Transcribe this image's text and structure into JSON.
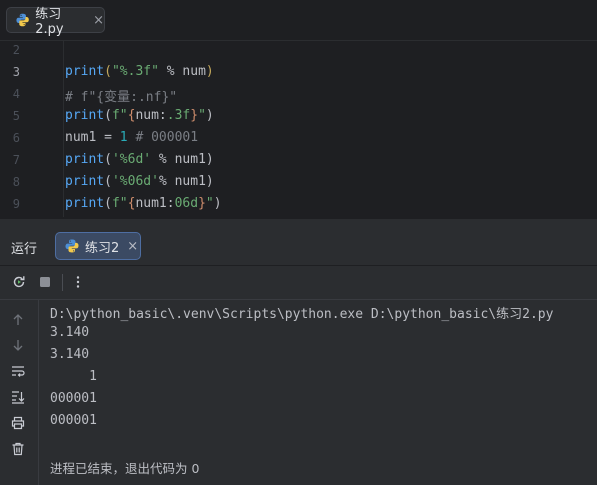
{
  "editor_tab": {
    "label": "练习2.py",
    "close": "×"
  },
  "editor": {
    "line_numbers": [
      "2",
      "3",
      "4",
      "5",
      "6",
      "7",
      "8",
      "9"
    ],
    "lines": [
      {
        "parts": []
      },
      {
        "parts": [
          {
            "t": "print",
            "c": "fn"
          },
          {
            "t": "(",
            "c": "bp"
          },
          {
            "t": "\"%.3f\"",
            "c": "str"
          },
          {
            "t": " % num",
            "c": "id"
          },
          {
            "t": ")",
            "c": "bp"
          }
        ]
      },
      {
        "parts": [
          {
            "t": "# f\"{变量:.nf}\"",
            "c": "cmt"
          }
        ]
      },
      {
        "parts": [
          {
            "t": "print",
            "c": "fn"
          },
          {
            "t": "(",
            "c": "id"
          },
          {
            "t": "f\"",
            "c": "str"
          },
          {
            "t": "{",
            "c": "fb"
          },
          {
            "t": "num:",
            "c": "id"
          },
          {
            "t": ".3f",
            "c": "str"
          },
          {
            "t": "}",
            "c": "fb"
          },
          {
            "t": "\"",
            "c": "str"
          },
          {
            "t": ")",
            "c": "id"
          }
        ]
      },
      {
        "parts": [
          {
            "t": "num1 = ",
            "c": "id"
          },
          {
            "t": "1",
            "c": "num"
          },
          {
            "t": " # 000001",
            "c": "cmt"
          }
        ]
      },
      {
        "parts": [
          {
            "t": "print",
            "c": "fn"
          },
          {
            "t": "(",
            "c": "id"
          },
          {
            "t": "'%6d'",
            "c": "str"
          },
          {
            "t": " % num1)",
            "c": "id"
          }
        ]
      },
      {
        "parts": [
          {
            "t": "print",
            "c": "fn"
          },
          {
            "t": "(",
            "c": "id"
          },
          {
            "t": "'%06d'",
            "c": "str"
          },
          {
            "t": "% num1)",
            "c": "id"
          }
        ]
      },
      {
        "parts": [
          {
            "t": "print",
            "c": "fn"
          },
          {
            "t": "(",
            "c": "id"
          },
          {
            "t": "f\"",
            "c": "str"
          },
          {
            "t": "{",
            "c": "fb"
          },
          {
            "t": "num1:",
            "c": "id"
          },
          {
            "t": "06d",
            "c": "str"
          },
          {
            "t": "}",
            "c": "fb"
          },
          {
            "t": "\"",
            "c": "str"
          },
          {
            "t": ")",
            "c": "id"
          }
        ]
      }
    ]
  },
  "run_panel": {
    "title": "运行",
    "tab_label": "练习2",
    "tab_close": "×",
    "toolbar_icons": [
      "rerun-icon",
      "stop-icon",
      "more-icon"
    ],
    "side_icons": [
      "arrow-up-icon",
      "arrow-down-icon",
      "soft-wrap-icon",
      "scroll-to-end-icon",
      "print-icon",
      "trash-icon"
    ]
  },
  "console": {
    "lines": [
      "D:\\python_basic\\.venv\\Scripts\\python.exe D:\\python_basic\\练习2.py",
      "3.140",
      "3.140",
      "     1",
      "000001",
      "000001",
      "",
      "进程已结束，退出代码为 0"
    ]
  },
  "colors": {
    "background": "#1e1f22",
    "panel": "#2b2d30",
    "keyword_fn": "#56a8f5",
    "string": "#6aab73",
    "number": "#2aacb8",
    "comment": "#7a7e85",
    "active_tab": "#3b4a63"
  }
}
